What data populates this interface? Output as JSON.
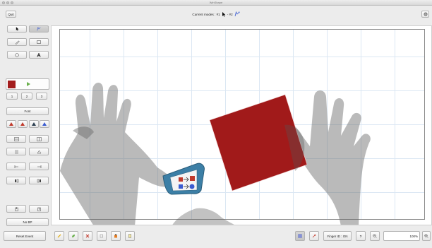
{
  "window": {
    "title": "WinShape"
  },
  "toolbar": {
    "quit_label": "Quit",
    "modes_text": "Current modes : #1",
    "modes_sep": "- #2"
  },
  "left_panel": {
    "width_values": [
      "1",
      "2",
      "3"
    ],
    "font_label": "Font",
    "no_bp_label": "No BP",
    "reset_label": "Reset Event"
  },
  "bottom": {
    "finger_label": "Finger ID : ON",
    "zoom_value": "100%"
  },
  "colors": {
    "current_color": "#a31d1d",
    "square_fill": "#a11a1a",
    "accent_blue": "#3a5bd0",
    "canvas_grid": "#dbe7f3"
  }
}
